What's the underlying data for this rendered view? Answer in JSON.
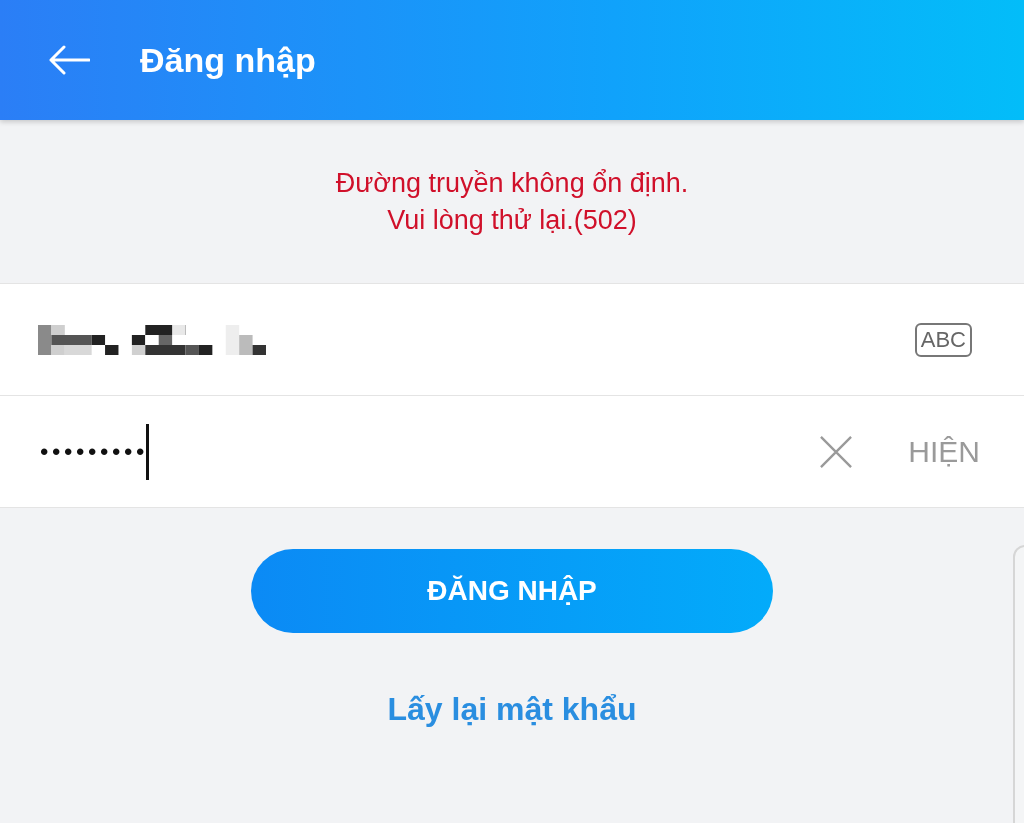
{
  "app_bar": {
    "title": "Đăng nhập"
  },
  "error_message": [
    "Đường truyền không ổn định.",
    "Vui lòng thử lại.(502)"
  ],
  "phone_field": {
    "keyboard_toggle": "ABC"
  },
  "password_field": {
    "value": "•••••••••",
    "focused": true,
    "show_label": "HIỆN"
  },
  "login_button": {
    "label": "ĐĂNG NHẬP"
  },
  "forgot_link": {
    "label": "Lấy lại mật khẩu"
  }
}
